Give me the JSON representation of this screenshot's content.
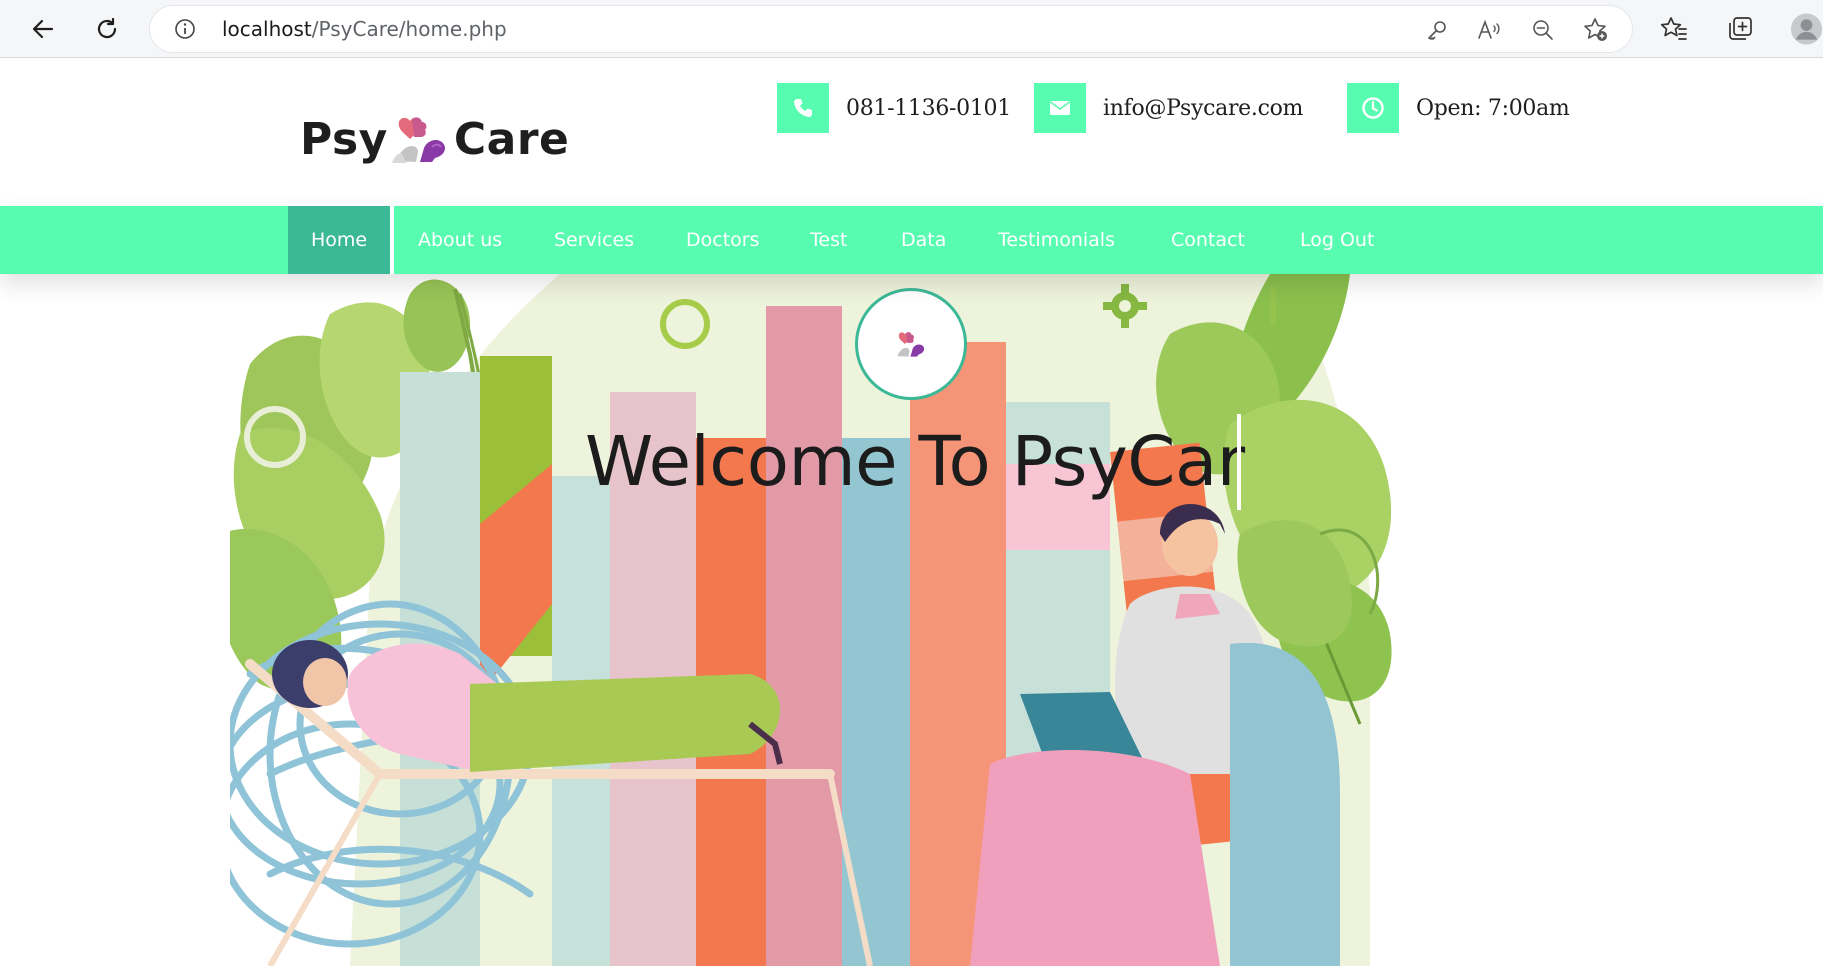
{
  "browser": {
    "url_host": "localhost",
    "url_path": "/PsyCare/home.php",
    "icons": [
      "back-icon",
      "reload-icon",
      "info-icon",
      "key-icon",
      "read-aloud-icon",
      "zoom-out-icon",
      "add-favorite-icon",
      "favorites-icon",
      "collections-icon",
      "profile-icon"
    ]
  },
  "header": {
    "logo_left": "Psy",
    "logo_right": "Care",
    "phone": "081-1136-0101",
    "email": "info@Psycare.com",
    "hours": "Open: 7:00am",
    "contact_icons": [
      "phone-icon",
      "envelope-icon",
      "clock-icon"
    ],
    "accent_color": "#58fcb0",
    "active_color": "#3bb896"
  },
  "nav": {
    "items": [
      {
        "label": "Home",
        "active": true
      },
      {
        "label": "About us"
      },
      {
        "label": "Services"
      },
      {
        "label": "Doctors"
      },
      {
        "label": "Test"
      },
      {
        "label": "Data"
      },
      {
        "label": "Testimonials"
      },
      {
        "label": "Contact"
      },
      {
        "label": "Log Out"
      }
    ]
  },
  "hero": {
    "title": "Welcome To PsyCar"
  }
}
